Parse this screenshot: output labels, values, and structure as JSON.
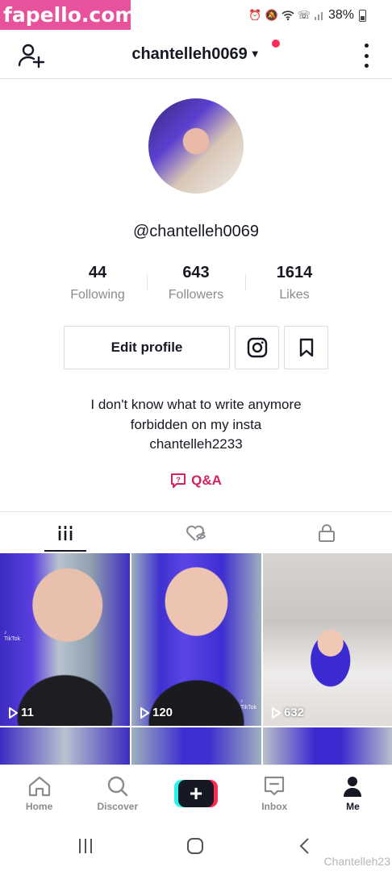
{
  "watermark": {
    "site": "fapello.com",
    "bottom": "Chantelleh23"
  },
  "status_bar": {
    "battery": "38%"
  },
  "header": {
    "username": "chantelleh0069",
    "caret": "▼"
  },
  "profile": {
    "handle": "@chantelleh0069",
    "stats": [
      {
        "value": "44",
        "label": "Following"
      },
      {
        "value": "643",
        "label": "Followers"
      },
      {
        "value": "1614",
        "label": "Likes"
      }
    ],
    "edit_profile_label": "Edit profile",
    "bio_lines": [
      "I don't know what to write anymore",
      "forbidden on my insta",
      "chantelleh2233"
    ],
    "qa_label": "Q&A"
  },
  "videos": [
    {
      "views": "11"
    },
    {
      "views": "120"
    },
    {
      "views": "632"
    },
    {
      "views": ""
    },
    {
      "views": ""
    },
    {
      "views": ""
    }
  ],
  "bottom_nav": [
    {
      "label": "Home",
      "icon": "home-icon"
    },
    {
      "label": "Discover",
      "icon": "search-icon"
    },
    {
      "label": "",
      "icon": "plus-icon"
    },
    {
      "label": "Inbox",
      "icon": "inbox-icon"
    },
    {
      "label": "Me",
      "icon": "person-icon"
    }
  ],
  "colors": {
    "accent": "#fe2c55",
    "qa": "#d3225d",
    "cyan": "#25f4ee",
    "text": "#161823",
    "muted": "#8a8b91"
  }
}
